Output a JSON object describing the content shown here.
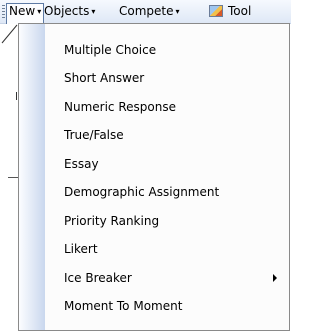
{
  "menubar": {
    "items": [
      {
        "label": "New"
      },
      {
        "label": "Objects"
      },
      {
        "label": "Compete"
      },
      {
        "label": "Tool"
      }
    ],
    "arrow_glyph": "▾",
    "tools_icon": "tools-icon"
  },
  "dropdown": {
    "items": [
      {
        "label": "Multiple Choice"
      },
      {
        "label": "Short Answer"
      },
      {
        "label": "Numeric Response"
      },
      {
        "label": "True/False"
      },
      {
        "label": "Essay"
      },
      {
        "label": "Demographic Assignment"
      },
      {
        "label": "Priority Ranking"
      },
      {
        "label": "Likert"
      },
      {
        "label": "Ice Breaker",
        "has_submenu": true
      },
      {
        "label": "Moment To Moment"
      }
    ]
  },
  "colors": {
    "active_border": "#5d7aa4",
    "gutter_end": "#c9d7ee"
  }
}
